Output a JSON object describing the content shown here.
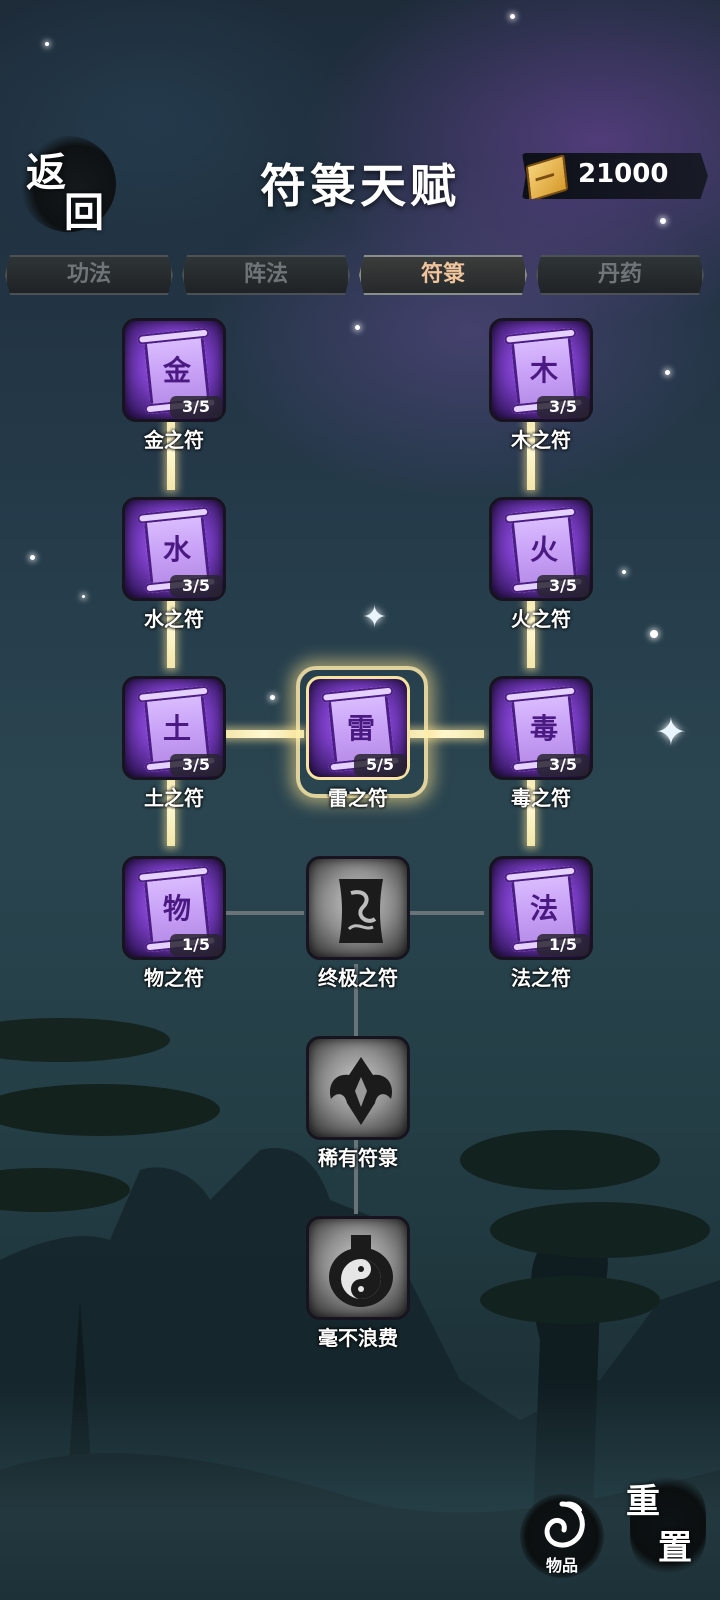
{
  "header": {
    "back_char_1": "返",
    "back_char_2": "回",
    "title": "符箓天赋",
    "currency_value": "21000",
    "currency_icon": "ticket-icon"
  },
  "tabs": [
    {
      "label": "功法",
      "active": false
    },
    {
      "label": "阵法",
      "active": false
    },
    {
      "label": "符箓",
      "active": true
    },
    {
      "label": "丹药",
      "active": false
    }
  ],
  "talents": {
    "metal": {
      "glyph": "金",
      "level": "3/5",
      "label": "金之符"
    },
    "wood": {
      "glyph": "木",
      "level": "3/5",
      "label": "木之符"
    },
    "water": {
      "glyph": "水",
      "level": "3/5",
      "label": "水之符"
    },
    "fire": {
      "glyph": "火",
      "level": "3/5",
      "label": "火之符"
    },
    "earth": {
      "glyph": "土",
      "level": "3/5",
      "label": "土之符"
    },
    "thunder": {
      "glyph": "雷",
      "level": "5/5",
      "label": "雷之符"
    },
    "poison": {
      "glyph": "毒",
      "level": "3/5",
      "label": "毒之符"
    },
    "object": {
      "glyph": "物",
      "level": "1/5",
      "label": "物之符"
    },
    "ultimate": {
      "label": "终极之符",
      "icon": "dark-scroll-icon"
    },
    "law": {
      "glyph": "法",
      "level": "1/5",
      "label": "法之符"
    },
    "rare": {
      "label": "稀有符箓",
      "icon": "demon-mask-icon"
    },
    "nowaste": {
      "label": "毫不浪费",
      "icon": "yin-yang-icon"
    }
  },
  "footer": {
    "items_label": "物品",
    "reset_char_1": "重",
    "reset_char_2": "置"
  },
  "colors": {
    "accent_tab": "#f0c49c",
    "talent_purple": "#7b3ec7",
    "path_gold": "#fff8d0",
    "path_grey": "#6a7478"
  }
}
